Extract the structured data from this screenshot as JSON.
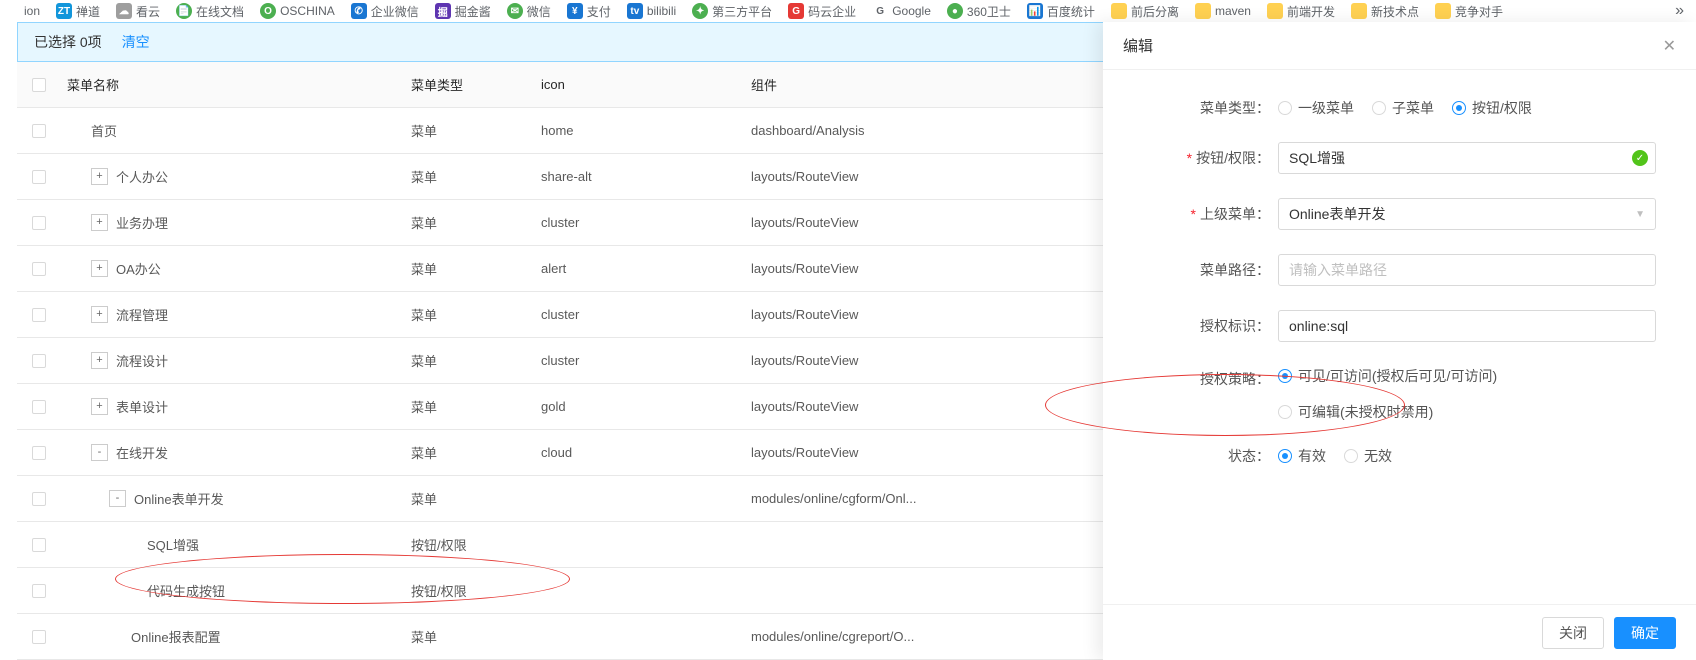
{
  "bookmarks": [
    {
      "label": "ion",
      "icon": "",
      "cls": ""
    },
    {
      "label": "禅道",
      "icon": "ZT",
      "cls": "bm-zt"
    },
    {
      "label": "看云",
      "icon": "☁",
      "cls": "bm-gray"
    },
    {
      "label": "在线文档",
      "icon": "📄",
      "cls": "bm-green"
    },
    {
      "label": "OSCHINA",
      "icon": "O",
      "cls": "bm-green"
    },
    {
      "label": "企业微信",
      "icon": "✆",
      "cls": "bm-blue"
    },
    {
      "label": "掘金酱",
      "icon": "掘",
      "cls": "bm-purple"
    },
    {
      "label": "微信",
      "icon": "✉",
      "cls": "bm-green"
    },
    {
      "label": "支付",
      "icon": "¥",
      "cls": "bm-blue"
    },
    {
      "label": "bilibili",
      "icon": "tv",
      "cls": "bm-blue"
    },
    {
      "label": "第三方平台",
      "icon": "✦",
      "cls": "bm-green"
    },
    {
      "label": "码云企业",
      "icon": "G",
      "cls": "bm-red"
    },
    {
      "label": "Google",
      "icon": "G",
      "cls": ""
    },
    {
      "label": "360卫士",
      "icon": "●",
      "cls": "bm-green"
    },
    {
      "label": "百度统计",
      "icon": "📊",
      "cls": "bm-blue"
    },
    {
      "label": "前后分离",
      "icon": "",
      "cls": "bm-folder"
    },
    {
      "label": "maven",
      "icon": "",
      "cls": "bm-folder"
    },
    {
      "label": "前端开发",
      "icon": "",
      "cls": "bm-folder"
    },
    {
      "label": "新技术点",
      "icon": "",
      "cls": "bm-folder"
    },
    {
      "label": "竞争对手",
      "icon": "",
      "cls": "bm-folder"
    }
  ],
  "selection": {
    "text": "已选择 0项",
    "clear": "清空"
  },
  "columns": {
    "name": "菜单名称",
    "type": "菜单类型",
    "icon": "icon",
    "comp": "组件"
  },
  "menuTypes": {
    "menu": "菜单",
    "button": "按钮/权限"
  },
  "rows": [
    {
      "name": "首页",
      "type": "menu",
      "icon": "home",
      "comp": "dashboard/Analysis",
      "indent": "indent-0",
      "exp": ""
    },
    {
      "name": "个人办公",
      "type": "menu",
      "icon": "share-alt",
      "comp": "layouts/RouteView",
      "indent": "indent-1",
      "exp": "+"
    },
    {
      "name": "业务办理",
      "type": "menu",
      "icon": "cluster",
      "comp": "layouts/RouteView",
      "indent": "indent-1",
      "exp": "+"
    },
    {
      "name": "OA办公",
      "type": "menu",
      "icon": "alert",
      "comp": "layouts/RouteView",
      "indent": "indent-1",
      "exp": "+"
    },
    {
      "name": "流程管理",
      "type": "menu",
      "icon": "cluster",
      "comp": "layouts/RouteView",
      "indent": "indent-1",
      "exp": "+"
    },
    {
      "name": "流程设计",
      "type": "menu",
      "icon": "cluster",
      "comp": "layouts/RouteView",
      "indent": "indent-1",
      "exp": "+"
    },
    {
      "name": "表单设计",
      "type": "menu",
      "icon": "gold",
      "comp": "layouts/RouteView",
      "indent": "indent-1",
      "exp": "+"
    },
    {
      "name": "在线开发",
      "type": "menu",
      "icon": "cloud",
      "comp": "layouts/RouteView",
      "indent": "indent-1",
      "exp": "-"
    },
    {
      "name": "Online表单开发",
      "type": "menu",
      "icon": "",
      "comp": "modules/online/cgform/Onl...",
      "indent": "indent-2",
      "exp": "-"
    },
    {
      "name": "SQL增强",
      "type": "button",
      "icon": "",
      "comp": "",
      "indent": "indent-3",
      "exp": ""
    },
    {
      "name": "代码生成按钮",
      "type": "button",
      "icon": "",
      "comp": "",
      "indent": "indent-3",
      "exp": ""
    },
    {
      "name": "Online报表配置",
      "type": "menu",
      "icon": "",
      "comp": "modules/online/cgreport/O...",
      "indent": "indent-3b",
      "exp": ""
    }
  ],
  "drawer": {
    "title": "编辑",
    "labels": {
      "menuType": "菜单类型：",
      "btnPerm": "按钮/权限：",
      "parent": "上级菜单：",
      "path": "菜单路径：",
      "authCode": "授权标识：",
      "authPolicy": "授权策略：",
      "status": "状态："
    },
    "menuTypeOpts": {
      "top": "一级菜单",
      "sub": "子菜单",
      "btn": "按钮/权限"
    },
    "btnPermValue": "SQL增强",
    "parentValue": "Online表单开发",
    "pathPlaceholder": "请输入菜单路径",
    "authCodeValue": "online:sql",
    "policyOpts": {
      "visible": "可见/可访问(授权后可见/可访问)",
      "editable": "可编辑(未授权时禁用)"
    },
    "statusOpts": {
      "valid": "有效",
      "invalid": "无效"
    },
    "footer": {
      "close": "关闭",
      "ok": "确定"
    }
  }
}
